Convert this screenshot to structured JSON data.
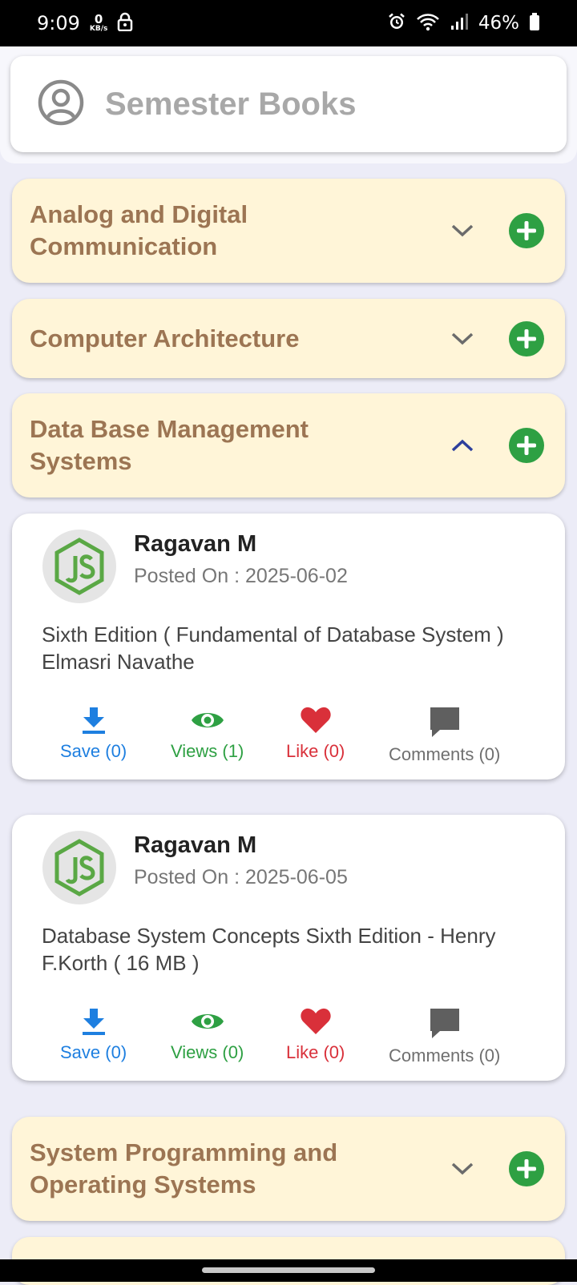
{
  "status_bar": {
    "time": "9:09",
    "net_speed": "0",
    "net_unit": "KB/s",
    "battery": "46%"
  },
  "header": {
    "title": "Semester Books",
    "icon": "user-circle-icon"
  },
  "subjects": [
    {
      "title": "Analog and Digital Communication",
      "expanded": false
    },
    {
      "title": "Computer Architecture",
      "expanded": false
    },
    {
      "title": "Data Base Management Systems",
      "expanded": true
    },
    {
      "title": "System Programming and Operating Systems",
      "expanded": false
    }
  ],
  "posts": [
    {
      "author": "Ragavan M",
      "posted": "Posted On : 2025-06-02",
      "description": "Sixth Edition ( Fundamental of Database System ) Elmasri Navathe",
      "save": "Save (0)",
      "views": "Views (1)",
      "like": "Like (0)",
      "comments": "Comments (0)"
    },
    {
      "author": "Ragavan M",
      "posted": "Posted On : 2025-06-05",
      "description": "Database System Concepts Sixth Edition - Henry F.Korth ( 16 MB )",
      "save": "Save (0)",
      "views": "Views (0)",
      "like": "Like (0)",
      "comments": "Comments (0)"
    }
  ],
  "colors": {
    "subject_bg": "#fff5d8",
    "subject_text": "#9c7553",
    "add_green": "#2ea043",
    "save_blue": "#1e7fe0",
    "like_red": "#d9303a"
  }
}
